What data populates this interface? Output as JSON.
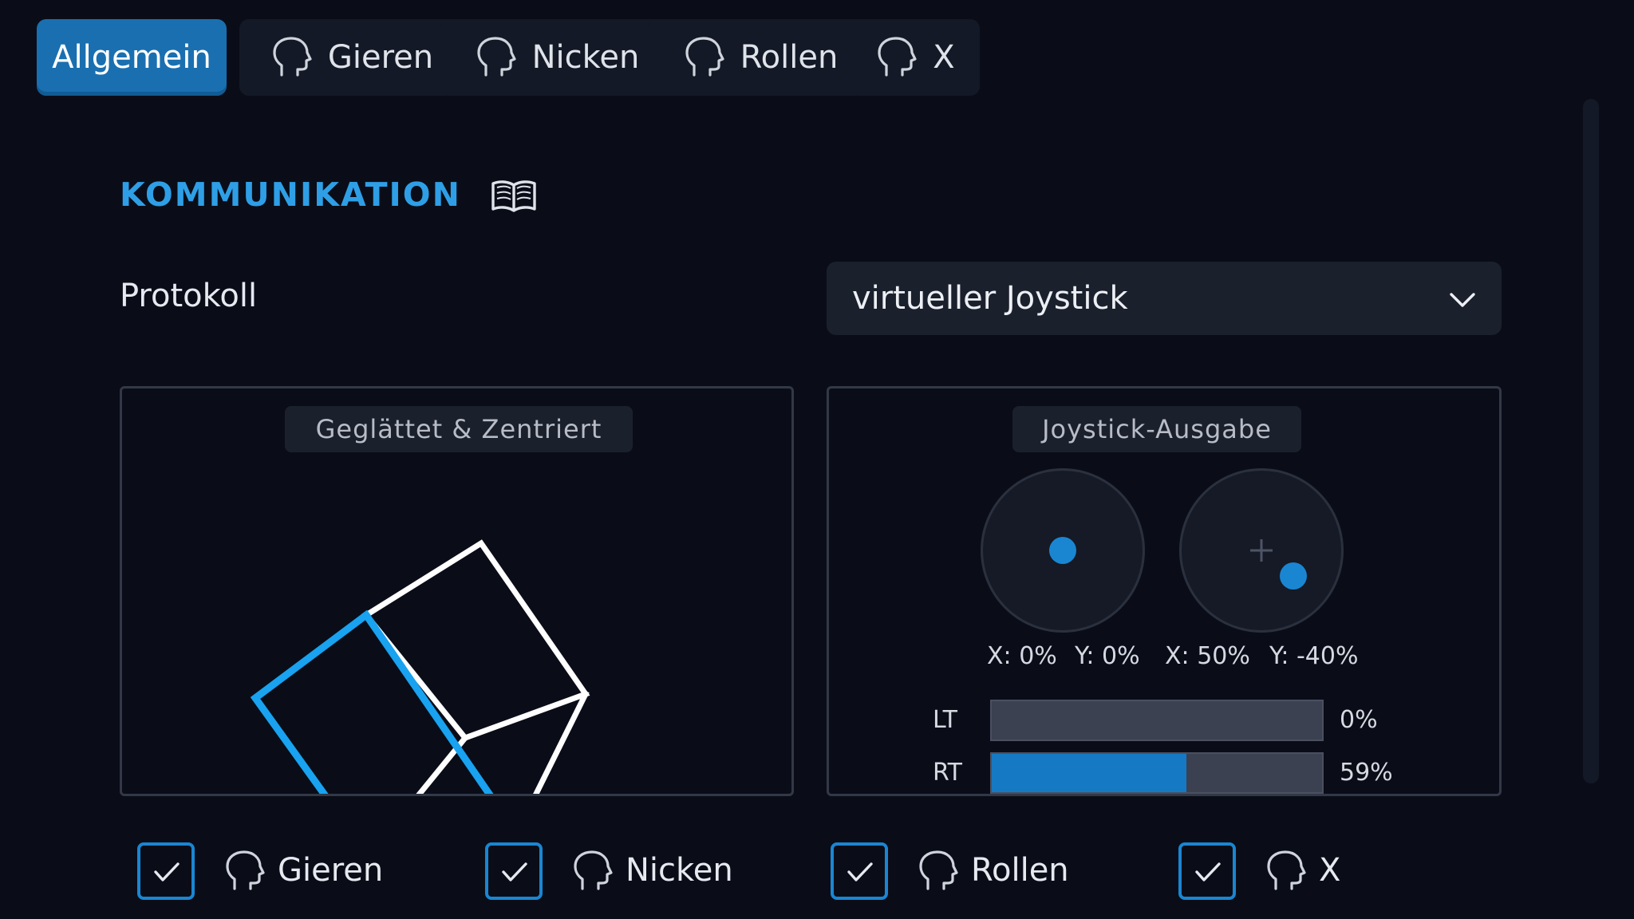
{
  "tabs": [
    {
      "label": "Allgemein",
      "icon": null,
      "active": true
    },
    {
      "label": "Gieren",
      "icon": "head-outline-icon",
      "active": false
    },
    {
      "label": "Nicken",
      "icon": "head-outline-icon",
      "active": false
    },
    {
      "label": "Rollen",
      "icon": "head-outline-icon",
      "active": false
    },
    {
      "label": "X",
      "icon": "head-outline-icon",
      "active": false
    }
  ],
  "section": {
    "title": "KOMMUNIKATION",
    "doc_icon": "book-icon"
  },
  "protocol": {
    "label": "Protokoll",
    "selected": "virtueller Joystick"
  },
  "panels": {
    "preview_title": "Geglättet & Zentriert",
    "output_title": "Joystick-Ausgabe"
  },
  "joystick": {
    "left": {
      "x_text": "X: 0%",
      "y_text": "Y: 0%",
      "x": 0,
      "y": 0
    },
    "right": {
      "x_text": "X: 50%",
      "y_text": "Y: -40%",
      "x": 50,
      "y": -40
    },
    "triggers": [
      {
        "label": "LT",
        "value_text": "0%",
        "value": 0
      },
      {
        "label": "RT",
        "value_text": "59%",
        "value": 59
      }
    ]
  },
  "axes_checkboxes": [
    {
      "label": "Gieren",
      "checked": true
    },
    {
      "label": "Nicken",
      "checked": true
    },
    {
      "label": "Rollen",
      "checked": true
    },
    {
      "label": "X",
      "checked": true
    }
  ],
  "colors": {
    "accent": "#1a86d2",
    "title_blue": "#2e9fe6",
    "background": "#0a0d18",
    "surface": "#1b202d"
  }
}
